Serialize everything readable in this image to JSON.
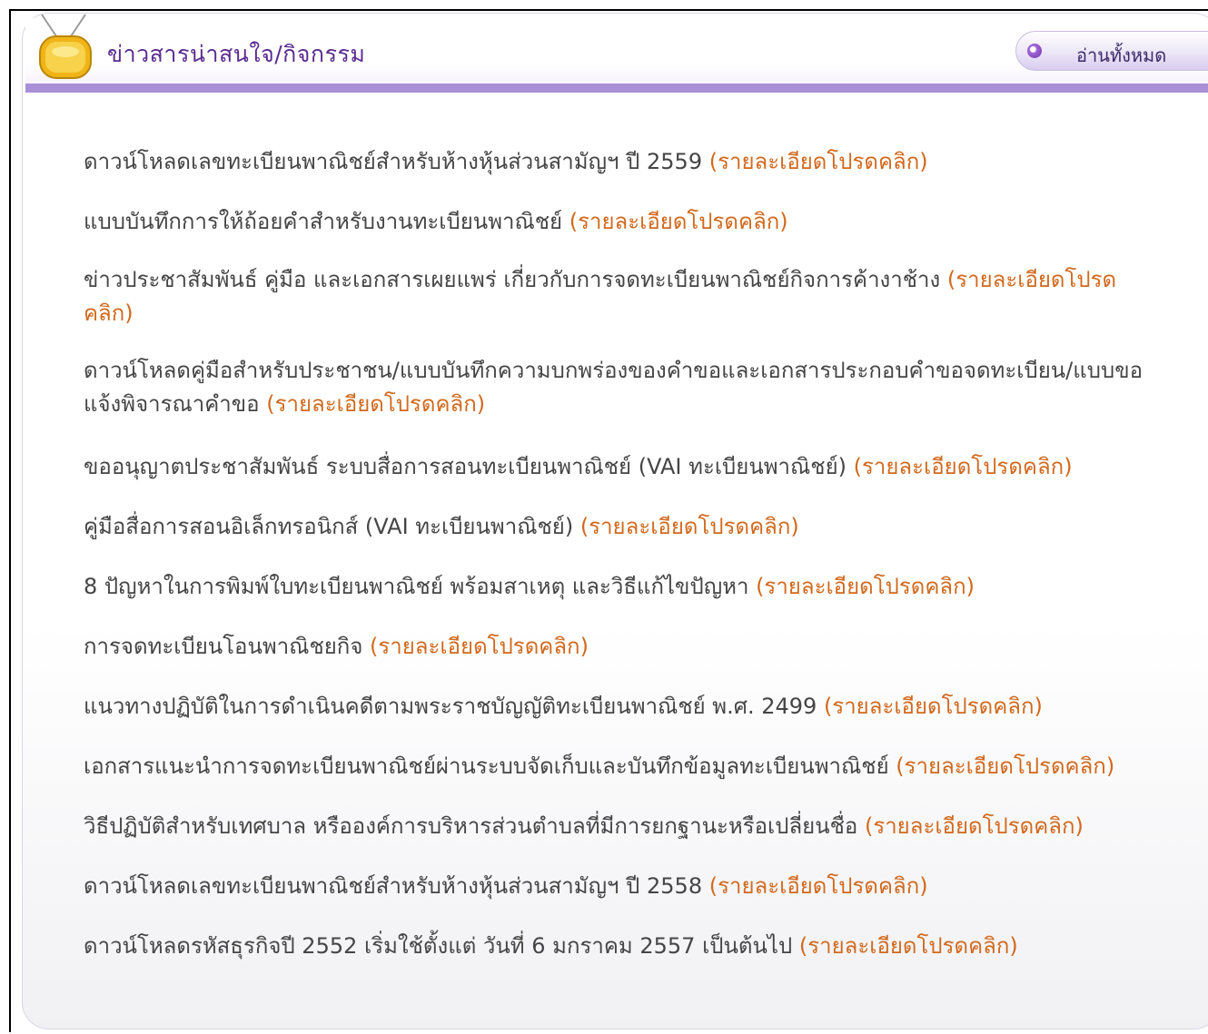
{
  "header": {
    "title": "ข่าวสารน่าสนใจ/กิจกรรม",
    "read_all_label": "อ่านทั้งหมด",
    "icon": "tv-icon"
  },
  "colors": {
    "accent": "#a98fd6",
    "title": "#5b2b91",
    "body_text": "#454545",
    "link": "#d2691e"
  },
  "news": [
    {
      "text": "ดาวน์โหลดเลขทะเบียนพาณิชย์สำหรับห้างหุ้นส่วนสามัญฯ ปี 2559 ",
      "link": "(รายละเอียดโปรดคลิก)"
    },
    {
      "text": "แบบบันทึกการให้ถ้อยคำสำหรับงานทะเบียนพาณิชย์ ",
      "link": "(รายละเอียดโปรดคลิก)"
    },
    {
      "text": "ข่าวประชาสัมพันธ์ คู่มือ และเอกสารเผยแพร่ เกี่ยวกับการจดทะเบียนพาณิชย์กิจการค้างาช้าง ",
      "link": "(รายละเอียดโปรดคลิก)"
    },
    {
      "text": "ดาวน์โหลดคู่มือสำหรับประชาชน/แบบบันทึกความบกพร่องของคำขอและเอกสารประกอบคำขอจดทะเบียน/แบบขอแจ้งพิจารณาคำขอ ",
      "link": "(รายละเอียดโปรดคลิก)"
    },
    {
      "text": "ขออนุญาตประชาสัมพันธ์ ระบบสื่อการสอนทะเบียนพาณิชย์ (VAI ทะเบียนพาณิชย์)  ",
      "link": "(รายละเอียดโปรดคลิก)"
    },
    {
      "text": "คู่มือสื่อการสอนอิเล็กทรอนิกส์ (VAI ทะเบียนพาณิชย์) ",
      "link": "(รายละเอียดโปรดคลิก)"
    },
    {
      "text": "8 ปัญหาในการพิมพ์ใบทะเบียนพาณิชย์ พร้อมสาเหตุ และวิธีแก้ไขปัญหา ",
      "link": "(รายละเอียดโปรดคลิก)"
    },
    {
      "text": "การจดทะเบียนโอนพาณิชยกิจ ",
      "link": "(รายละเอียดโปรดคลิก)"
    },
    {
      "text": "แนวทางปฏิบัติในการดำเนินคดีตามพระราชบัญญัติทะเบียนพาณิชย์ พ.ศ. 2499 ",
      "link": "(รายละเอียดโปรดคลิก)"
    },
    {
      "text": "เอกสารแนะนำการจดทะเบียนพาณิชย์ผ่านระบบจัดเก็บและบันทึกข้อมูลทะเบียนพาณิชย์ ",
      "link": "(รายละเอียดโปรดคลิก)"
    },
    {
      "text": "วิธีปฏิบัติสำหรับเทศบาล หรือองค์การบริหารส่วนตำบลที่มีการยกฐานะหรือเปลี่ยนชื่อ ",
      "link": "(รายละเอียดโปรดคลิก)"
    },
    {
      "text": "ดาวน์โหลดเลขทะเบียนพาณิชย์สำหรับห้างหุ้นส่วนสามัญฯ ปี 2558 ",
      "link": "(รายละเอียดโปรดคลิก)"
    },
    {
      "text": "ดาวน์โหลดรหัสธุรกิจปี 2552 เริ่มใช้ตั้งแต่ วันที่ 6 มกราคม 2557 เป็นต้นไป  ",
      "link": "(รายละเอียดโปรดคลิก)"
    }
  ]
}
